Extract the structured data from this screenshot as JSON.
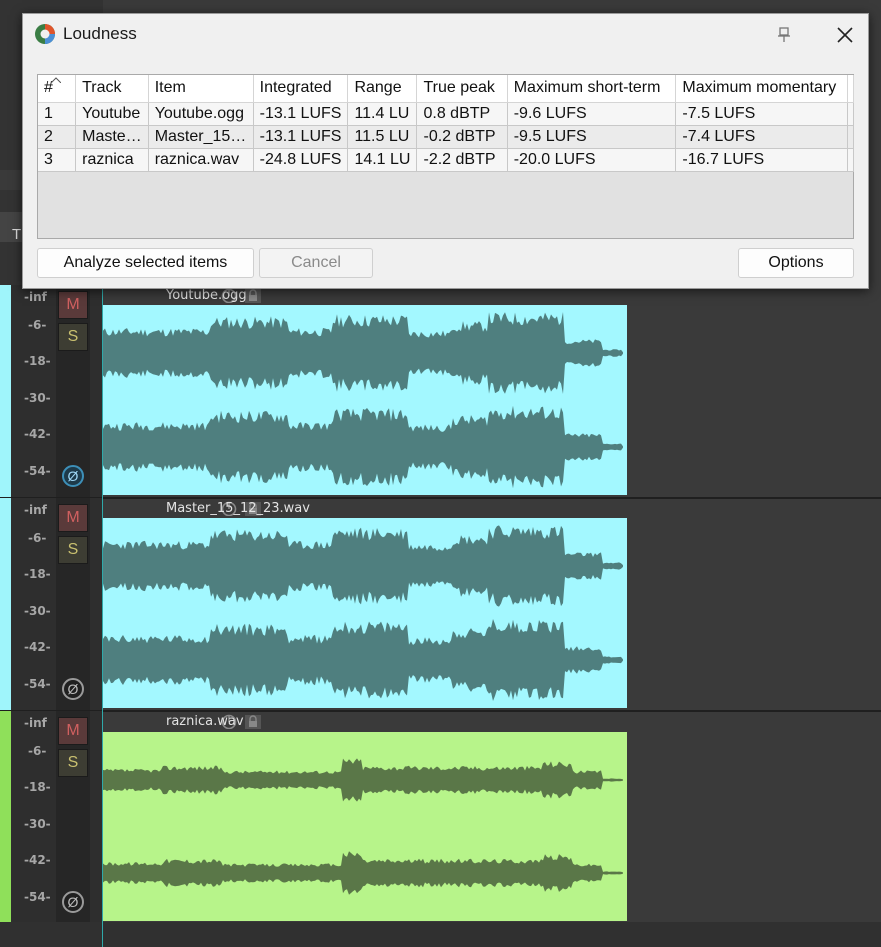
{
  "dialog": {
    "title": "Loudness",
    "columns": [
      "#",
      "Track",
      "Item",
      "Integrated",
      "Range",
      "True peak",
      "Maximum short-term",
      "Maximum momentary"
    ],
    "rows": [
      [
        "1",
        "Youtube",
        "Youtube.ogg",
        "-13.1 LUFS",
        "11.4 LU",
        "0.8 dBTP",
        "-9.6 LUFS",
        "-7.5 LUFS"
      ],
      [
        "2",
        "Maste…",
        "Master_15…",
        "-13.1 LUFS",
        "11.5 LU",
        "-0.2 dBTP",
        "-9.5 LUFS",
        "-7.4 LUFS"
      ],
      [
        "3",
        "raznica",
        "raznica.wav",
        "-24.8 LUFS",
        "14.1 LU",
        "-2.2 dBTP",
        "-20.0 LUFS",
        "-16.7 LUFS"
      ]
    ],
    "buttons": {
      "analyze": "Analyze selected items",
      "cancel": "Cancel",
      "options": "Options"
    }
  },
  "daw": {
    "background_label": "T",
    "meter_labels": [
      "-inf",
      "-6-",
      "-18-",
      "-30-",
      "-42-",
      "-54-"
    ],
    "mute_label": "M",
    "solo_label": "S",
    "phase_label": "Ø",
    "tracks": [
      {
        "item": "Youtube.ogg",
        "color": "#9ff5fb",
        "wave_color": "#a3f8ff",
        "phase_active": true
      },
      {
        "item": "Master_15_12_23.wav",
        "color": "#9ff5fb",
        "wave_color": "#a3f8ff",
        "phase_active": false
      },
      {
        "item": "raznica.wav",
        "color": "#8fe05a",
        "wave_color": "#b7f48a",
        "phase_active": false
      }
    ]
  }
}
